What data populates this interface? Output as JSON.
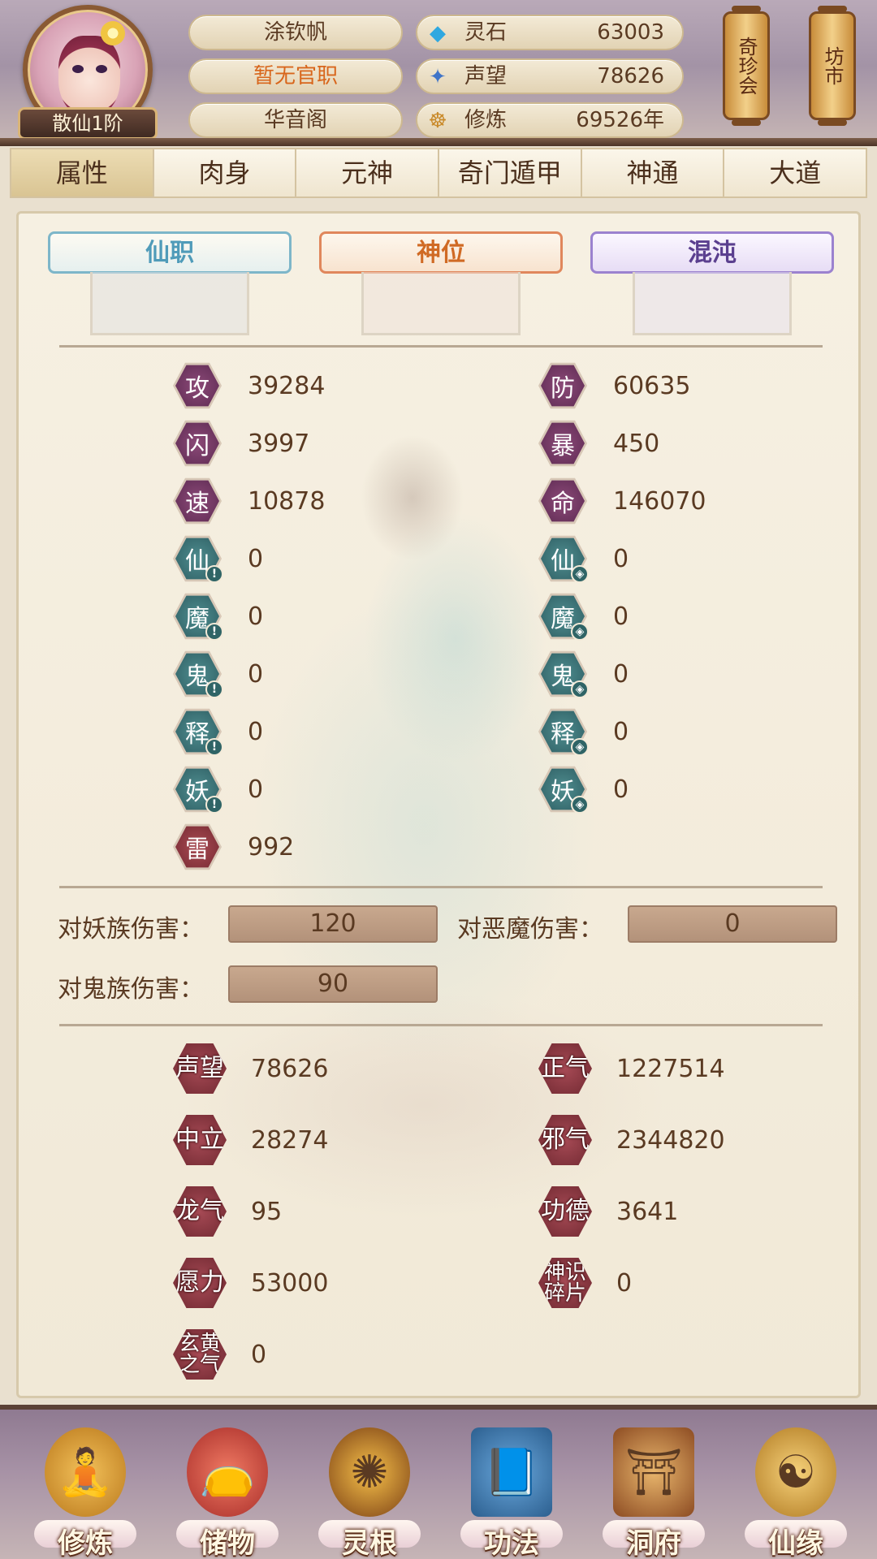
{
  "header": {
    "player_name": "涂钦帆",
    "official_position": "暂无官职",
    "sect": "华音阁",
    "rank": "散仙1阶",
    "resources": [
      {
        "icon": "spirit-stone-icon",
        "label": "灵石",
        "value": "63003"
      },
      {
        "icon": "reputation-icon",
        "label": "声望",
        "value": "78626"
      },
      {
        "icon": "cultivation-icon",
        "label": "修炼",
        "value": "69526年"
      }
    ],
    "buttons": {
      "treasure_fair": "奇珍会",
      "market": "坊市"
    }
  },
  "tabs": [
    {
      "label": "属性",
      "active": true
    },
    {
      "label": "肉身",
      "active": false
    },
    {
      "label": "元神",
      "active": false
    },
    {
      "label": "奇门遁甲",
      "active": false
    },
    {
      "label": "神通",
      "active": false
    },
    {
      "label": "大道",
      "active": false
    }
  ],
  "ranks": {
    "xianzhi": "仙职",
    "shenwei": "神位",
    "hundun": "混沌"
  },
  "stats": {
    "left": [
      {
        "icon": "攻",
        "value": "39284",
        "color": "purple"
      },
      {
        "icon": "闪",
        "value": "3997",
        "color": "purple"
      },
      {
        "icon": "速",
        "value": "10878",
        "color": "purple"
      },
      {
        "icon": "仙",
        "value": "0",
        "color": "teal"
      },
      {
        "icon": "魔",
        "value": "0",
        "color": "teal"
      },
      {
        "icon": "鬼",
        "value": "0",
        "color": "teal"
      },
      {
        "icon": "释",
        "value": "0",
        "color": "teal"
      },
      {
        "icon": "妖",
        "value": "0",
        "color": "teal"
      },
      {
        "icon": "雷",
        "value": "992",
        "color": "red"
      }
    ],
    "right": [
      {
        "icon": "防",
        "value": "60635",
        "color": "purple"
      },
      {
        "icon": "暴",
        "value": "450",
        "color": "purple"
      },
      {
        "icon": "命",
        "value": "146070",
        "color": "purple"
      },
      {
        "icon": "仙",
        "value": "0",
        "color": "teal"
      },
      {
        "icon": "魔",
        "value": "0",
        "color": "teal"
      },
      {
        "icon": "鬼",
        "value": "0",
        "color": "teal"
      },
      {
        "icon": "释",
        "value": "0",
        "color": "teal"
      },
      {
        "icon": "妖",
        "value": "0",
        "color": "teal"
      }
    ]
  },
  "damage": {
    "vs_yao_label": "对妖族伤害：",
    "vs_yao_value": "120",
    "vs_demon_label": "对恶魔伤害：",
    "vs_demon_value": "0",
    "vs_ghost_label": "对鬼族伤害：",
    "vs_ghost_value": "90"
  },
  "misc": {
    "left": [
      {
        "icon": "声望",
        "value": "78626"
      },
      {
        "icon": "中立",
        "value": "28274"
      },
      {
        "icon": "龙气",
        "value": "95"
      },
      {
        "icon": "愿力",
        "value": "53000"
      },
      {
        "icon": "玄黄之气",
        "value": "0"
      }
    ],
    "right": [
      {
        "icon": "正气",
        "value": "1227514"
      },
      {
        "icon": "邪气",
        "value": "2344820"
      },
      {
        "icon": "功德",
        "value": "3641"
      },
      {
        "icon": "神识碎片",
        "value": "0"
      }
    ]
  },
  "bottom_nav": [
    {
      "label": "修炼",
      "icon": "cultivate-icon"
    },
    {
      "label": "储物",
      "icon": "storage-bag-icon"
    },
    {
      "label": "灵根",
      "icon": "spirit-root-icon"
    },
    {
      "label": "功法",
      "icon": "technique-book-icon"
    },
    {
      "label": "洞府",
      "icon": "cave-dwelling-icon"
    },
    {
      "label": "仙缘",
      "icon": "gourd-icon"
    }
  ],
  "colors": {
    "accent_orange": "#d8661c",
    "stat_purple": "#6d3562",
    "stat_teal": "#3b7074",
    "stat_red": "#8e3640"
  }
}
